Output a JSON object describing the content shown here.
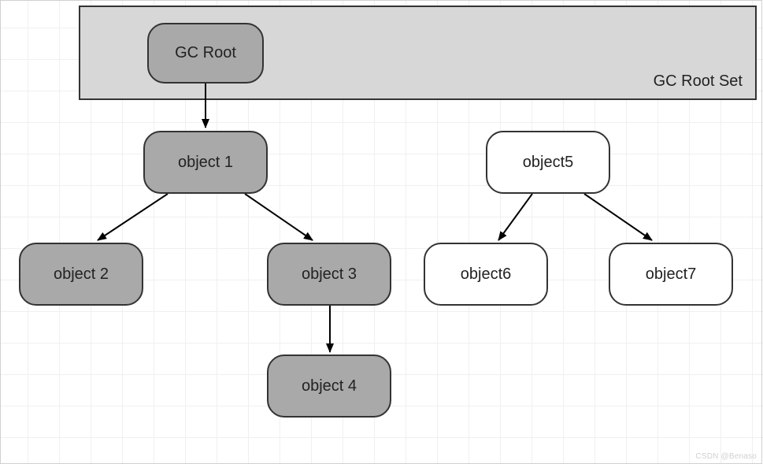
{
  "diagram": {
    "rootSetLabel": "GC Root Set",
    "nodes": {
      "gcRoot": "GC Root",
      "object1": "object 1",
      "object2": "object 2",
      "object3": "object 3",
      "object4": "object 4",
      "object5": "object5",
      "object6": "object6",
      "object7": "object7"
    }
  },
  "watermark": "CSDN @Benaso"
}
